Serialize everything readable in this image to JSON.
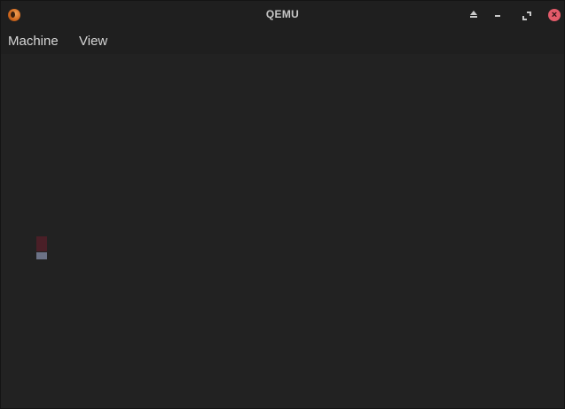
{
  "window": {
    "title": "QEMU"
  },
  "titlebar": {
    "buttons": {
      "eject": "eject-icon",
      "minimize": "minimize-icon",
      "maximize": "maximize-icon",
      "close": "close-icon"
    }
  },
  "menubar": {
    "items": [
      {
        "label": "Machine"
      },
      {
        "label": "View"
      }
    ]
  },
  "colors": {
    "titlebar_bg": "#1f1f1f",
    "display_bg": "#222222",
    "close_button": "#e35b6a",
    "text": "#d6d6d6"
  }
}
